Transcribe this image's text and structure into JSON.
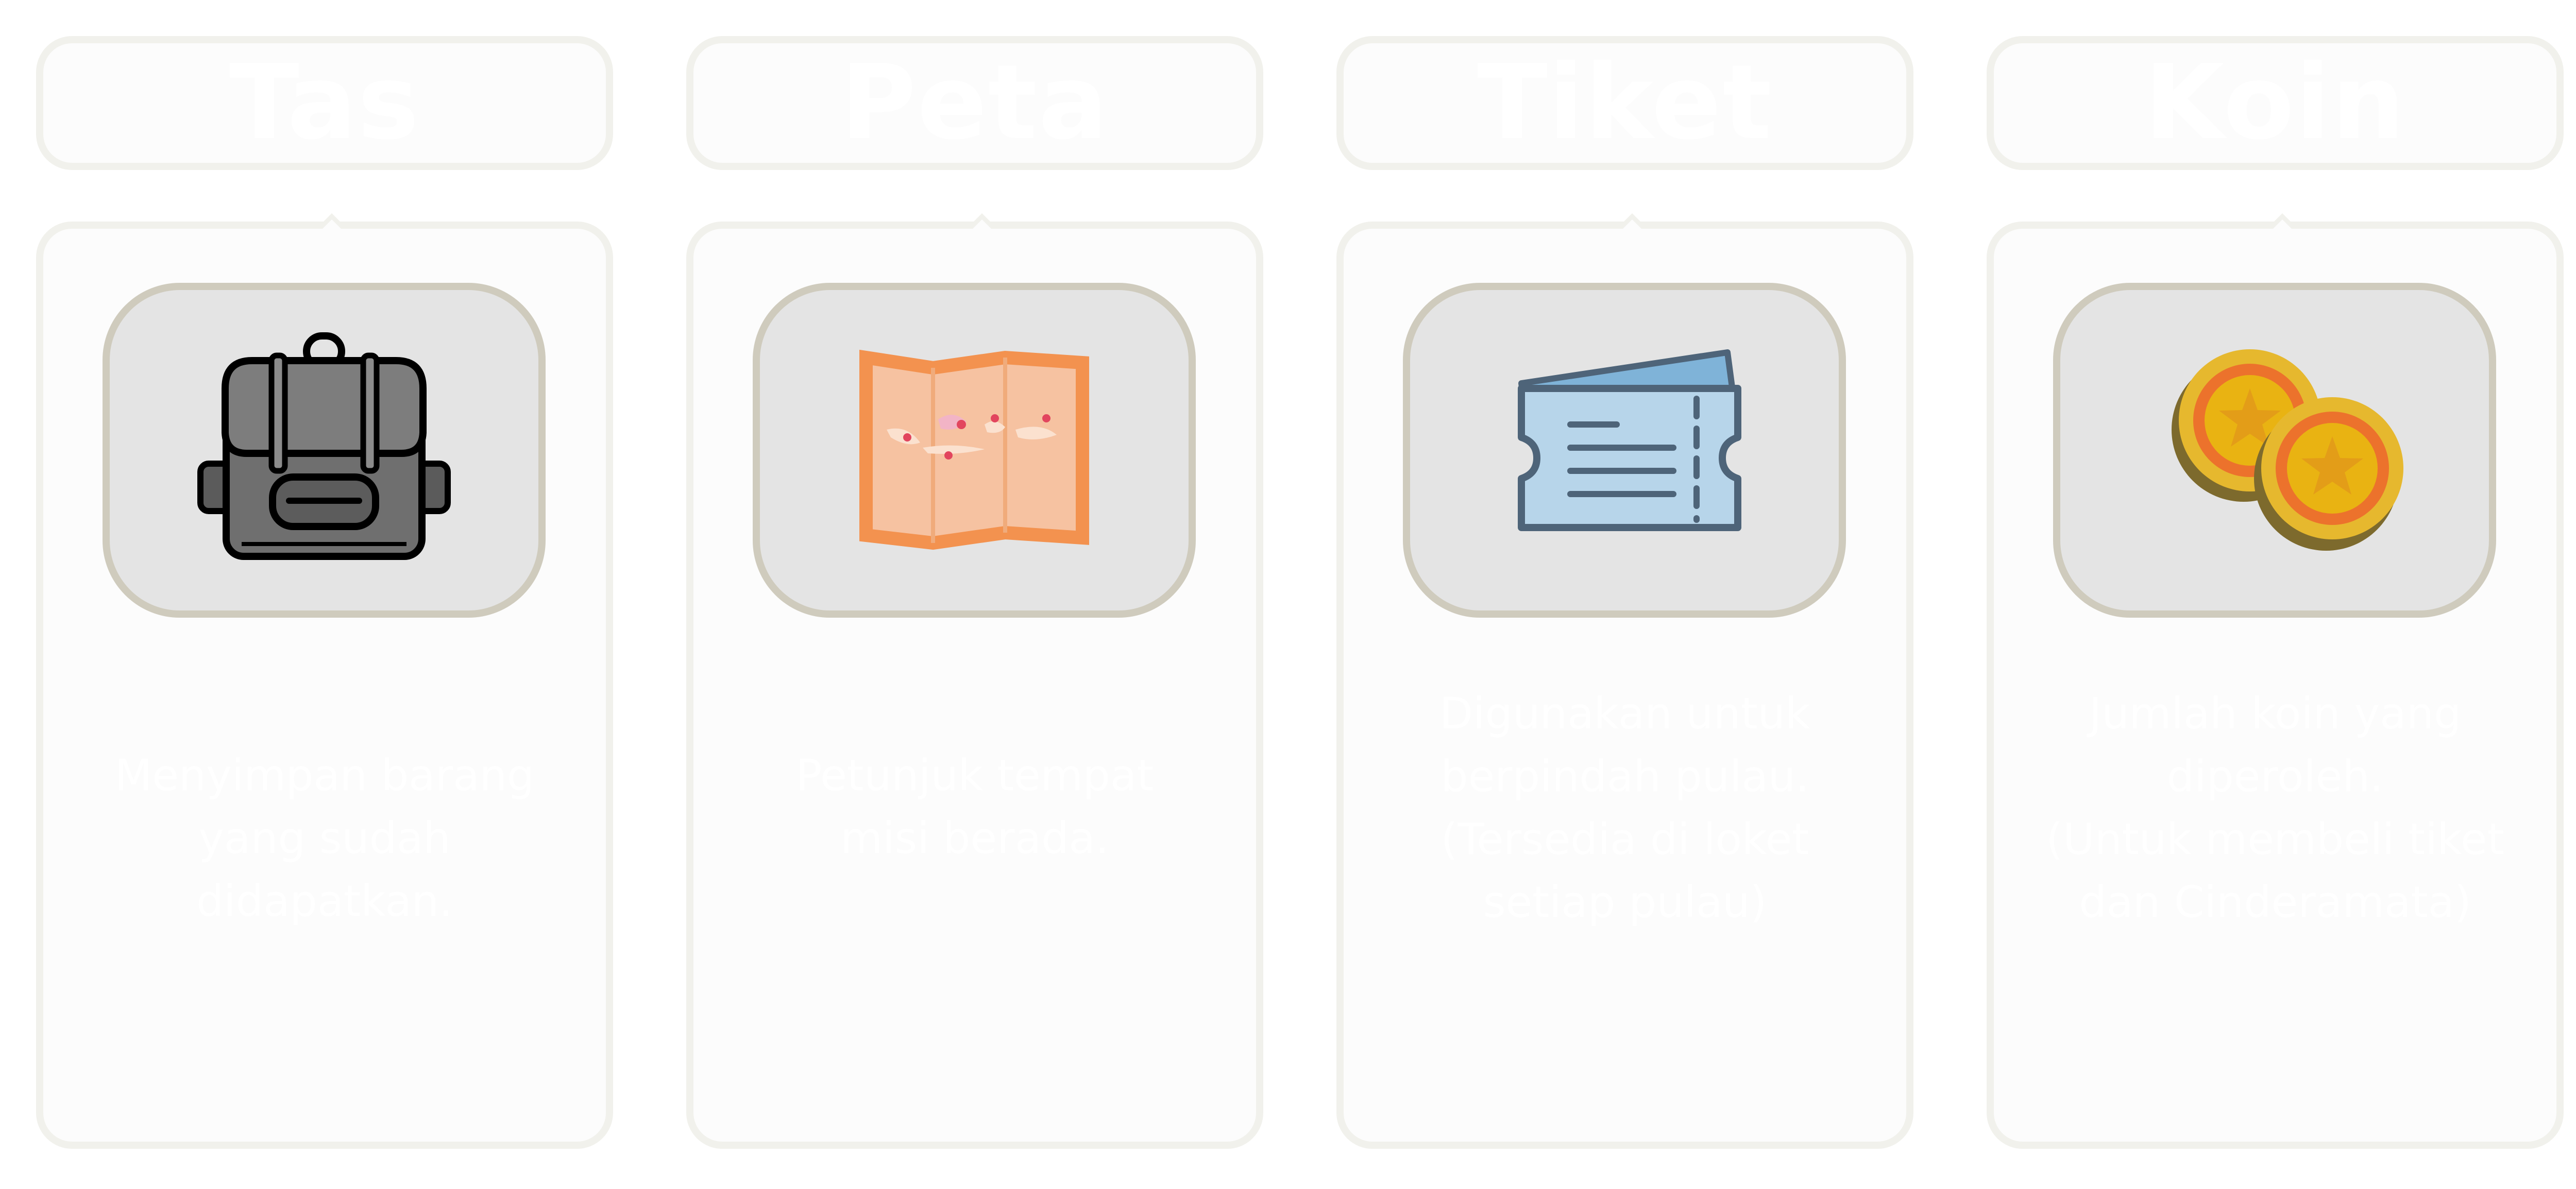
{
  "cards": [
    {
      "title": "Tas",
      "icon": "backpack-icon",
      "description": [
        "Menyimpan barang",
        "yang sudah didapatkan."
      ]
    },
    {
      "title": "Peta",
      "icon": "map-icon",
      "description": [
        "Petunjuk tempat",
        "misi berada."
      ]
    },
    {
      "title": "Tiket",
      "icon": "ticket-icon",
      "description": [
        "Digunakan untuk",
        "berpindah pulau.",
        "(Tersedia di loket",
        "setiap pulau)"
      ]
    },
    {
      "title": "Koin",
      "icon": "coins-icon",
      "description": [
        "Jumlah koin yang",
        "diperoleh.",
        "(Untuk membeli tiket",
        "dan Cinderamata)"
      ]
    }
  ],
  "colors": {
    "card_background": "#fcfcfc",
    "card_border": "#f1f1ec",
    "icon_box_background": "#e4e4e4",
    "icon_box_border": "#cfcbbd",
    "text": "#ffffff"
  }
}
